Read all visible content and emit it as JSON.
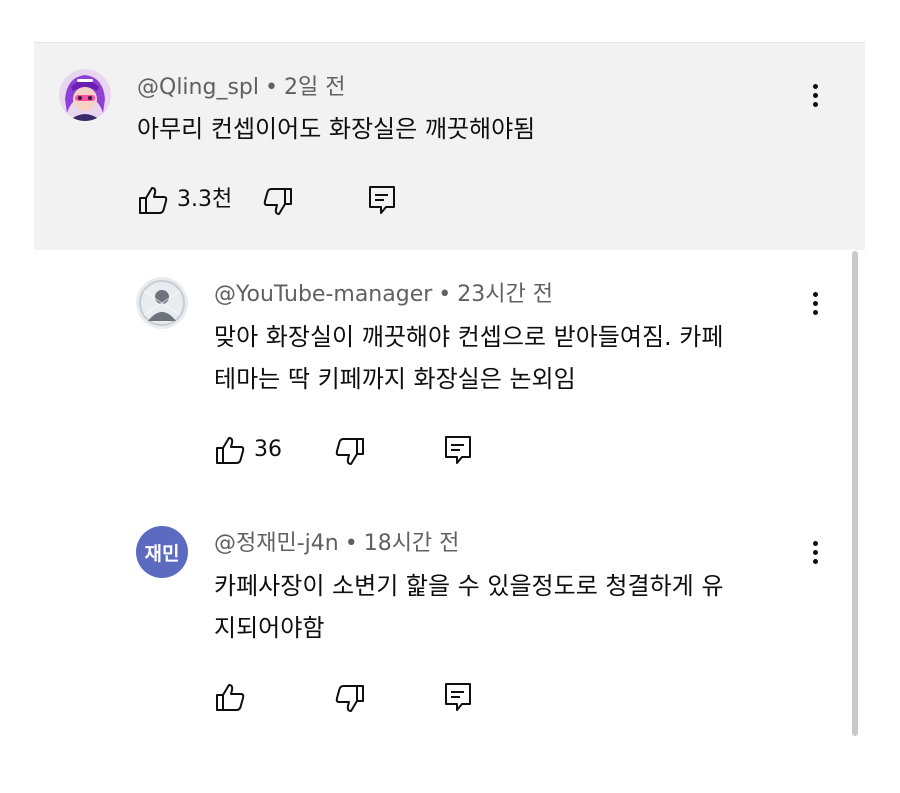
{
  "comments": [
    {
      "handle": "@Qling_spl",
      "time": "2일 전",
      "text_lines": [
        "아무리 컨셉이어도 화장실은 깨끗해야됨"
      ],
      "likes": "3.3천",
      "avatar_icon": "anime-girl-avatar"
    },
    {
      "handle": "@YouTube-manager",
      "time": "23시간 전",
      "text_lines": [
        "맞아 화장실이 깨끗해야 컨셉으로 받아들여짐. 카페",
        "테마는 딱 키페까지 화장실은 논외임"
      ],
      "likes": "36",
      "avatar_icon": "default-user-avatar"
    },
    {
      "handle": "@정재민-j4n",
      "time": "18시간 전",
      "text_lines": [
        "카페사장이 소변기 핥을 수 있을정도로 청결하게 유",
        "지되어야함"
      ],
      "likes": "",
      "avatar_initials": "재민",
      "avatar_color": "#5c6bc0"
    }
  ],
  "separator": "•",
  "icons": {
    "like": "thumb-up-icon",
    "dislike": "thumb-down-icon",
    "reply": "reply-comment-icon",
    "more": "more-vertical-icon"
  },
  "colors": {
    "highlight_bg": "#f2f2f2",
    "meta_text": "#606060",
    "body_text": "#0f0f0f"
  }
}
